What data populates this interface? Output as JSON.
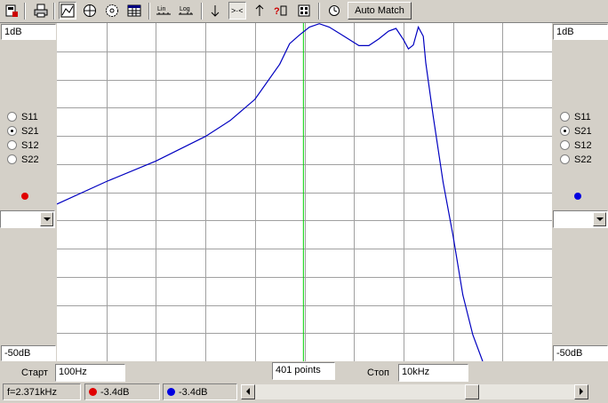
{
  "toolbar": {
    "buttons": [
      {
        "name": "save-icon"
      },
      {
        "name": "print-icon"
      },
      {
        "name": "chart-icon"
      },
      {
        "name": "polar-icon"
      },
      {
        "name": "smith-icon"
      },
      {
        "name": "table-icon"
      },
      {
        "name": "lin-scale-icon",
        "text": "Lin"
      },
      {
        "name": "log-scale-icon",
        "text": "Log"
      },
      {
        "name": "arrow-down-icon"
      },
      {
        "name": "zoom-marker-icon"
      },
      {
        "name": "arrow-up-icon"
      },
      {
        "name": "help-icon"
      },
      {
        "name": "component-icon"
      },
      {
        "name": "clock-icon"
      }
    ],
    "auto_match_label": "Auto Match"
  },
  "left_panel": {
    "top_value": "1dB",
    "bottom_value": "-50dB",
    "params": [
      "S11",
      "S21",
      "S12",
      "S22"
    ],
    "selected": "S21",
    "marker_color": "#e00000"
  },
  "right_panel": {
    "top_value": "1dB",
    "bottom_value": "-50dB",
    "params": [
      "S11",
      "S21",
      "S12",
      "S22"
    ],
    "selected": "S21",
    "marker_color": "#0000e0"
  },
  "sweep": {
    "start_label": "Старт",
    "start_value": "100Hz",
    "points_value": "401 points",
    "stop_label": "Стоп",
    "stop_value": "10kHz"
  },
  "status": {
    "frequency": "f=2.371kHz",
    "marker1_value": "-3.4dB",
    "marker1_color": "#e00000",
    "marker2_value": "-3.4dB",
    "marker2_color": "#0000e0"
  },
  "chart_data": {
    "type": "line",
    "title": "",
    "xlabel": "",
    "ylabel": "",
    "ylim": [
      -50,
      1
    ],
    "xlim": [
      0,
      1
    ],
    "grid": {
      "vertical_lines": 10,
      "horizontal_lines": 12
    },
    "cursor_x": 0.497,
    "series": [
      {
        "color": "#0000c0",
        "x": [
          0,
          0.1,
          0.2,
          0.3,
          0.35,
          0.4,
          0.45,
          0.47,
          0.49,
          0.51,
          0.53,
          0.55,
          0.58,
          0.61,
          0.63,
          0.65,
          0.67,
          0.685,
          0.7,
          0.71,
          0.72,
          0.73,
          0.74,
          0.745,
          0.76,
          0.78,
          0.8,
          0.82,
          0.84,
          0.86
        ],
        "y": [
          -26.3,
          -22.9,
          -19.8,
          -16.1,
          -13.7,
          -10.5,
          -5.2,
          -2.1,
          -0.8,
          0.4,
          0.9,
          0.4,
          -1.0,
          -2.4,
          -2.4,
          -1.4,
          -0.2,
          0.2,
          -1.5,
          -2.9,
          -2.3,
          0.4,
          -1.0,
          -5.0,
          -13.0,
          -23.0,
          -31.0,
          -40.0,
          -46.0,
          -50.0
        ]
      }
    ]
  }
}
